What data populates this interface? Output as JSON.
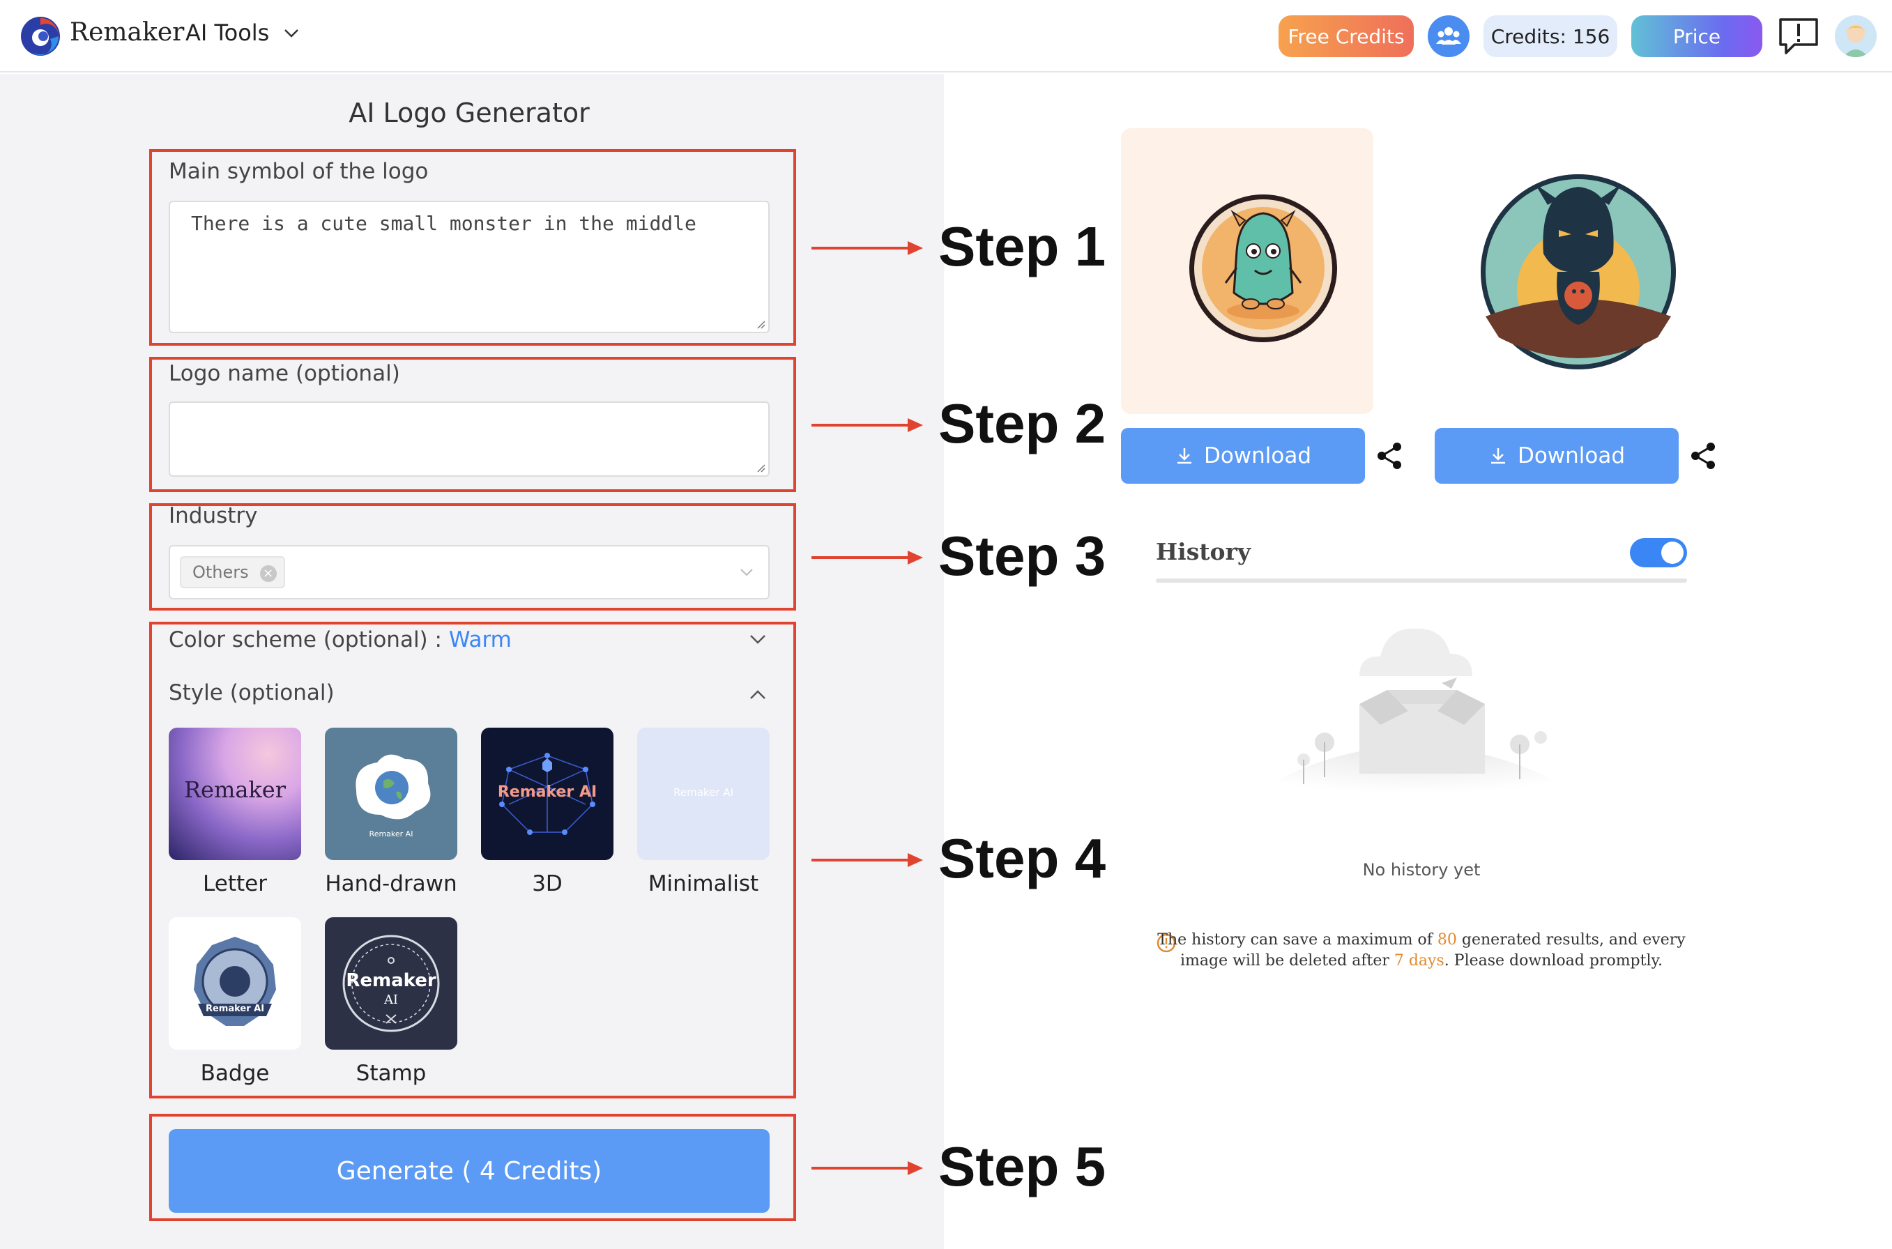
{
  "header": {
    "brand": "Remaker",
    "tools_menu": "AI Tools",
    "free_credits": "Free Credits",
    "credits": "Credits: 156",
    "price": "Price"
  },
  "form": {
    "title": "AI Logo Generator",
    "main_symbol_label": "Main symbol of the logo",
    "main_symbol_value": "There is a cute small monster in the middle",
    "logo_name_label": "Logo name (optional)",
    "logo_name_value": "",
    "industry_label": "Industry",
    "industry_tag": "Others",
    "color_label": "Color scheme (optional) : ",
    "color_value": "Warm",
    "style_label": "Style (optional)",
    "styles": [
      {
        "label": "Letter",
        "thumb_text": "Remaker"
      },
      {
        "label": "Hand-drawn",
        "thumb_text": "Remaker AI"
      },
      {
        "label": "3D",
        "thumb_text": "Remaker AI"
      },
      {
        "label": "Minimalist",
        "thumb_text": "Remaker AI"
      },
      {
        "label": "Badge",
        "thumb_text": "Remaker AI"
      },
      {
        "label": "Stamp",
        "thumb_text": "Remaker",
        "thumb_sub": "AI"
      }
    ],
    "generate_button": "Generate ( 4 Credits)"
  },
  "steps": [
    "Step 1",
    "Step 2",
    "Step 3",
    "Step 4",
    "Step 5"
  ],
  "results": {
    "download_label": "Download"
  },
  "history": {
    "title": "History",
    "toggle_on": true,
    "empty_text": "No history yet",
    "note_1": "The history can save a maximum of ",
    "note_max": "80",
    "note_2": " generated results, and every image will be deleted after ",
    "note_days": "7 days",
    "note_3": ". Please download promptly."
  },
  "colors": {
    "accent_blue": "#5b9af5",
    "step_red": "#e0432f",
    "highlight_orange": "#e08a2e"
  },
  "icons": [
    "brand-logo-icon",
    "chevron-down-icon",
    "community-icon",
    "feedback-icon",
    "download-icon",
    "share-icon",
    "warning-icon"
  ]
}
